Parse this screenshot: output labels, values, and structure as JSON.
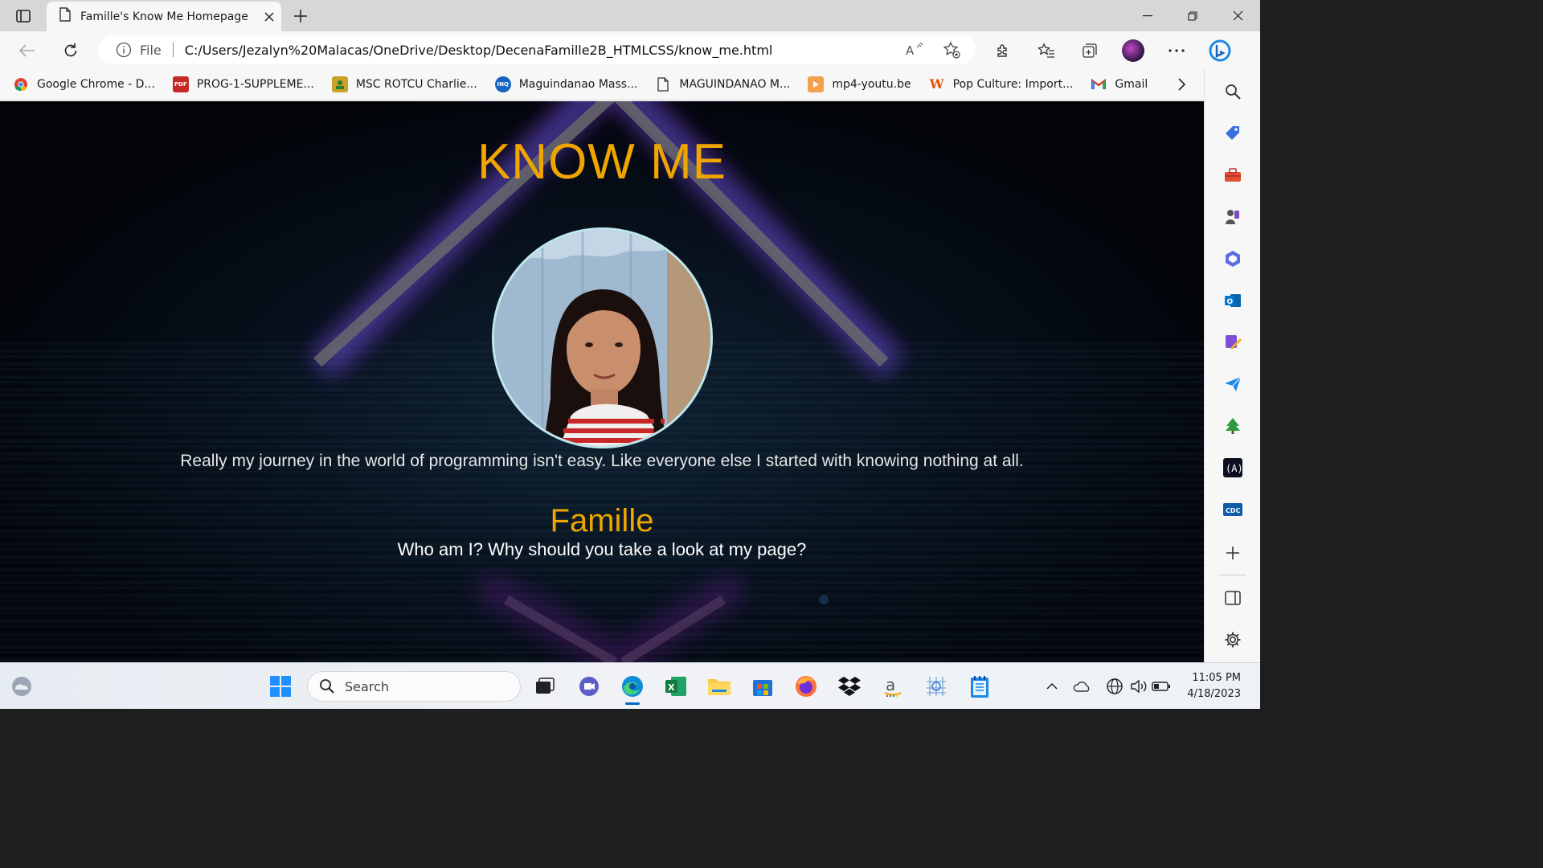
{
  "browser": {
    "tab_title": "Famille's Know Me Homepage",
    "url_scheme": "File",
    "url": "C:/Users/Jezalyn%20Malacas/OneDrive/Desktop/DecenaFamille2B_HTMLCSS/know_me.html"
  },
  "bookmarks": [
    {
      "label": "Google Chrome - D...",
      "icon": "chrome-icon"
    },
    {
      "label": "PROG-1-SUPPLEME...",
      "icon": "pdf-icon"
    },
    {
      "label": "MSC ROTCU Charlie...",
      "icon": "msc-icon"
    },
    {
      "label": "Maguindanao Mass...",
      "icon": "inq-icon"
    },
    {
      "label": "MAGUINDANAO M...",
      "icon": "document-icon"
    },
    {
      "label": "mp4-youtu.be",
      "icon": "video-icon"
    },
    {
      "label": "Pop Culture: Import...",
      "icon": "w-icon"
    },
    {
      "label": "Gmail",
      "icon": "gmail-icon"
    }
  ],
  "page": {
    "heading": "KNOW ME",
    "bio": "Really my journey in the world of programming isn't easy. Like everyone else I started with knowing nothing at all.",
    "name": "Famille",
    "tagline": "Who am I? Why should you take a look at my page?"
  },
  "taskbar": {
    "search_placeholder": "Search",
    "time": "11:05 PM",
    "date": "4/18/2023"
  },
  "colors": {
    "accent": "#f0a500",
    "photo_border": "#bfe7ee"
  }
}
